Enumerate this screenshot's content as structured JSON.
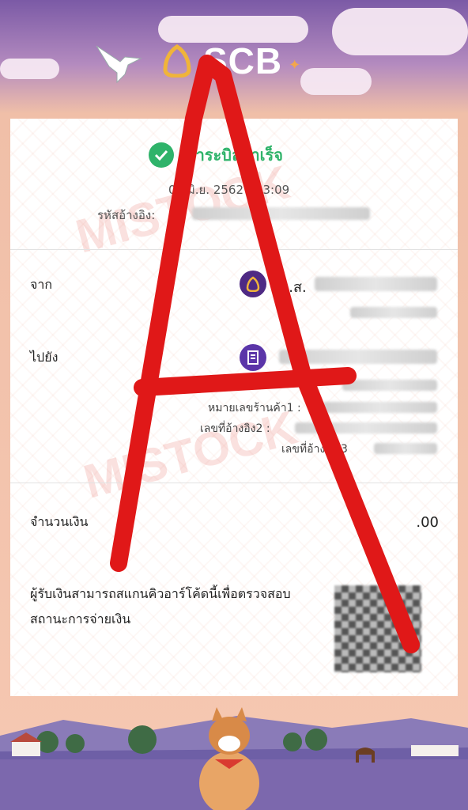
{
  "brand": {
    "name": "SCB",
    "spark": "✦"
  },
  "receipt": {
    "status": "ชำระบิลสำเร็จ",
    "date": "02 มิ.ย. 2562 - 13:09",
    "ref_label": "รหัสอ้างอิง:",
    "from_label": "จาก",
    "from_name": "น.ส.",
    "to_label": "ไปยัง",
    "merchant_label": "หมายเลขร้านค้า1 :",
    "ref2_label": "เลขที่อ้างอิง2 :",
    "ref3_label": "เลขที่อ้างอิง 3",
    "amount_label": "จำนวนเงิน",
    "amount_value": ".00",
    "qr_text": "ผู้รับเงินสามารถสแกนคิวอาร์โค้ดนี้เพื่อตรวจสอบสถานะการจ่ายเงิน"
  },
  "colors": {
    "success": "#2fb36a",
    "brand": "#4e2a84",
    "gold": "#f0b43a"
  }
}
